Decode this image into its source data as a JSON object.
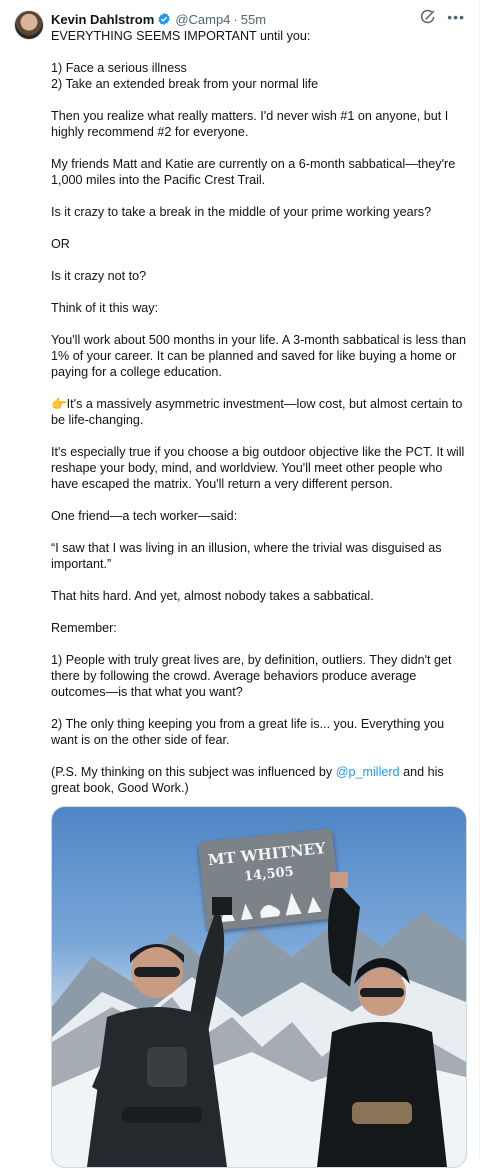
{
  "tweet": {
    "author_name": "Kevin Dahlstrom",
    "handle": "@Camp4",
    "separator": "·",
    "time": "55m",
    "paragraphs": [
      "EVERYTHING SEEMS IMPORTANT until you:",
      "1) Face a serious illness\n2) Take an extended break from your normal life",
      "Then you realize what really matters. I'd never wish #1 on anyone, but I highly recommend #2 for everyone.",
      "My friends Matt and Katie are currently on a 6-month sabbatical—they're 1,000 miles into the Pacific Crest Trail.",
      "Is it crazy to take a break in the middle of your prime working years?",
      "OR",
      "Is it crazy not to?",
      "Think of it this way:",
      "You'll work about 500 months in your life. A 3-month sabbatical is less than 1% of your career. It can be planned and saved for like buying a home or paying for a college education.",
      "👉It's a massively asymmetric investment—low cost, but almost certain to be life-changing.",
      "It's especially true if you choose a big outdoor objective like the PCT. It will reshape your body, mind, and worldview. You'll meet other people who have escaped the matrix. You'll return a very different person.",
      "One friend—a tech worker—said:",
      "“I saw that I was living in an illusion, where the trivial was disguised as important.”",
      "That hits hard. And yet, almost nobody takes a sabbatical.",
      "Remember:",
      "1) People with truly great lives are, by definition, outliers. They didn't get there by following the crowd. Average behaviors produce average outcomes—is that what you want?",
      "2) The only thing keeping you from a great life is... you. Everything you want is on the other side of fear."
    ],
    "ps_before": "(P.S. My thinking on this subject was influenced by ",
    "ps_mention": "@p_millerd",
    "ps_after": " and his great book, Good Work.)",
    "photo": {
      "sign_line1": "MT WHITNEY",
      "sign_line2": "14,505"
    },
    "icons": {
      "verified": "verified-badge-icon",
      "grok": "grok-icon",
      "more": "more-icon"
    },
    "colors": {
      "accent": "#1d9bf0",
      "secondary_text": "#536471"
    }
  }
}
